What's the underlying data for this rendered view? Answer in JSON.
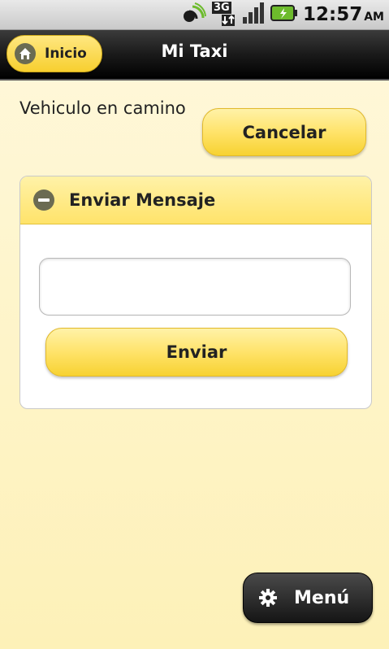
{
  "status_bar": {
    "network_label": "3G",
    "time": "12:57",
    "ampm": "AM"
  },
  "header": {
    "home_label": "Inicio",
    "title": "Mi Taxi"
  },
  "main": {
    "status_text": "Vehiculo en camino",
    "cancel_label": "Cancelar"
  },
  "panel": {
    "title": "Enviar Mensaje",
    "message_value": "",
    "send_label": "Enviar"
  },
  "menu": {
    "label": "Menú"
  },
  "colors": {
    "accent_yellow": "#ffe36a",
    "header_dark": "#1a1a1a",
    "background": "#fdf1b8"
  }
}
